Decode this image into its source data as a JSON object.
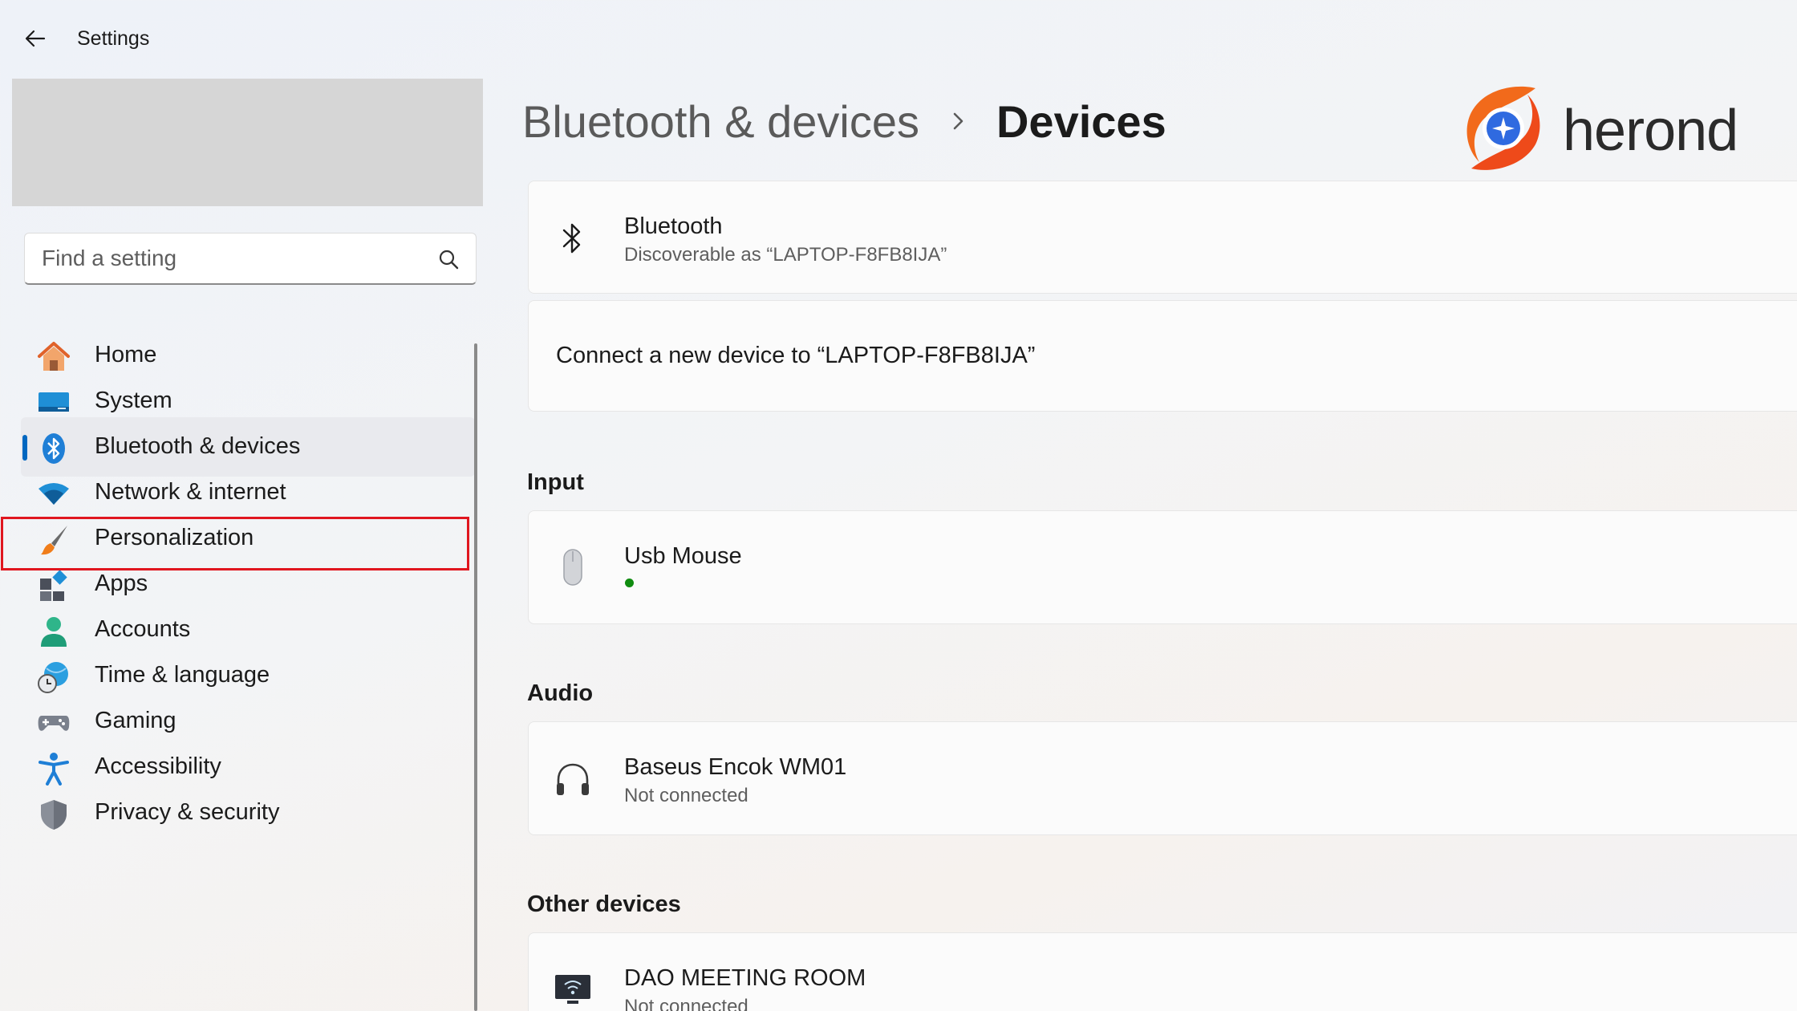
{
  "window": {
    "title": "Settings"
  },
  "search": {
    "placeholder": "Find a setting"
  },
  "sidebar": {
    "items": [
      {
        "label": "Home",
        "icon": "home-icon"
      },
      {
        "label": "System",
        "icon": "system-icon"
      },
      {
        "label": "Bluetooth & devices",
        "icon": "bluetooth-icon",
        "selected": true
      },
      {
        "label": "Network & internet",
        "icon": "wifi-icon",
        "highlighted": true
      },
      {
        "label": "Personalization",
        "icon": "brush-icon"
      },
      {
        "label": "Apps",
        "icon": "apps-icon"
      },
      {
        "label": "Accounts",
        "icon": "account-icon"
      },
      {
        "label": "Time & language",
        "icon": "globe-clock-icon"
      },
      {
        "label": "Gaming",
        "icon": "gamepad-icon"
      },
      {
        "label": "Accessibility",
        "icon": "accessibility-icon"
      },
      {
        "label": "Privacy & security",
        "icon": "shield-icon"
      }
    ]
  },
  "header": {
    "breadcrumb_parent": "Bluetooth & devices",
    "breadcrumb_current": "Devices"
  },
  "logo": {
    "text": "herond"
  },
  "bluetooth_card": {
    "title": "Bluetooth",
    "subtitle": "Discoverable as “LAPTOP-F8FB8IJA”"
  },
  "connect_card": {
    "label": "Connect a new device to “LAPTOP-F8FB8IJA”"
  },
  "sections": {
    "input": {
      "title": "Input",
      "devices": [
        {
          "name": "Usb Mouse",
          "status": "connected",
          "icon": "mouse-icon"
        }
      ]
    },
    "audio": {
      "title": "Audio",
      "devices": [
        {
          "name": "Baseus Encok WM01",
          "status": "Not connected",
          "icon": "headphones-icon"
        }
      ]
    },
    "other": {
      "title": "Other devices",
      "devices": [
        {
          "name": "DAO MEETING ROOM",
          "status": "Not connected",
          "icon": "display-icon"
        }
      ]
    }
  },
  "colors": {
    "accent": "#0067c0",
    "highlight": "#e0161f",
    "connected": "#108c10"
  }
}
